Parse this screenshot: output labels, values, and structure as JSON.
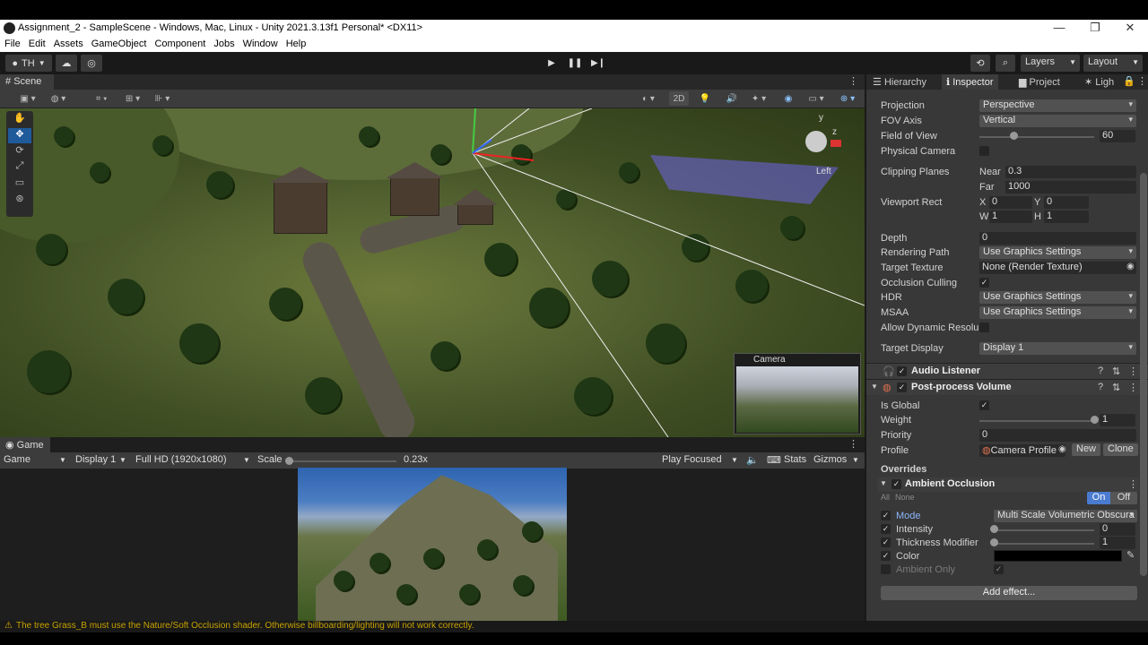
{
  "window": {
    "title": "Assignment_2 - SampleScene - Windows, Mac, Linux - Unity 2021.3.13f1 Personal* <DX11>",
    "minimize": "—",
    "maximize": "❐",
    "close": "✕"
  },
  "menu": [
    "File",
    "Edit",
    "Assets",
    "GameObject",
    "Component",
    "Jobs",
    "Window",
    "Help"
  ],
  "toolbar": {
    "account": "TH",
    "play_icon": "▶",
    "pause_icon": "❚❚",
    "step_icon": "▶❙",
    "layers": "Layers",
    "layout": "Layout"
  },
  "scene": {
    "tab": "Scene",
    "mode_2d": "2D",
    "gizmo_axis_y": "y",
    "gizmo_axis_z": "z",
    "gizmo_label": "Left",
    "camera_preview_label": "Camera"
  },
  "game": {
    "tab": "Game",
    "view_select": "Game",
    "display": "Display 1",
    "resolution": "Full HD (1920x1080)",
    "scale_label": "Scale",
    "scale_value": "0.23x",
    "play_mode": "Play Focused",
    "stats": "Stats",
    "gizmos": "Gizmos"
  },
  "status": {
    "warning": "The tree Grass_B must use the Nature/Soft Occlusion shader. Otherwise billboarding/lighting will not work correctly."
  },
  "panels": {
    "hierarchy": "Hierarchy",
    "inspector": "Inspector",
    "project": "Project",
    "lighting": "Ligh"
  },
  "inspector": {
    "projection_label": "Projection",
    "projection_value": "Perspective",
    "fov_axis_label": "FOV Axis",
    "fov_axis_value": "Vertical",
    "fov_label": "Field of View",
    "fov_value": "60",
    "fov_fraction": 0.3,
    "physical_camera_label": "Physical Camera",
    "clipping_label": "Clipping Planes",
    "near_label": "Near",
    "near_value": "0.3",
    "far_label": "Far",
    "far_value": "1000",
    "viewport_label": "Viewport Rect",
    "x_label": "X",
    "x_value": "0",
    "y_label": "Y",
    "y_value": "0",
    "w_label": "W",
    "w_value": "1",
    "h_label": "H",
    "h_value": "1",
    "depth_label": "Depth",
    "depth_value": "0",
    "rendering_path_label": "Rendering Path",
    "rendering_path_value": "Use Graphics Settings",
    "target_texture_label": "Target Texture",
    "target_texture_value": "None (Render Texture)",
    "occlusion_label": "Occlusion Culling",
    "hdr_label": "HDR",
    "hdr_value": "Use Graphics Settings",
    "msaa_label": "MSAA",
    "msaa_value": "Use Graphics Settings",
    "dynamic_res_label": "Allow Dynamic Resolu",
    "target_display_label": "Target Display",
    "target_display_value": "Display 1",
    "audio_listener": "Audio Listener",
    "post_process": "Post-process Volume",
    "is_global_label": "Is Global",
    "weight_label": "Weight",
    "weight_value": "1",
    "weight_fraction": 1.0,
    "priority_label": "Priority",
    "priority_value": "0",
    "profile_label": "Profile",
    "profile_value": "Camera Profile",
    "new_button": "New",
    "clone_button": "Clone",
    "overrides_label": "Overrides",
    "ambient_occlusion": "Ambient Occlusion",
    "all_label": "All",
    "none_label": "None",
    "on_button": "On",
    "off_button": "Off",
    "mode_label": "Mode",
    "mode_value": "Multi Scale Volumetric Obscura",
    "intensity_label": "Intensity",
    "intensity_value": "0",
    "intensity_fraction": 0.0,
    "thickness_label": "Thickness Modifier",
    "thickness_value": "1",
    "thickness_fraction": 0.0,
    "color_label": "Color",
    "ambient_only_label": "Ambient Only",
    "add_effect": "Add effect..."
  },
  "colors": {
    "accent": "#4a7bd0",
    "warning": "#c8a300",
    "panel": "#383838"
  }
}
